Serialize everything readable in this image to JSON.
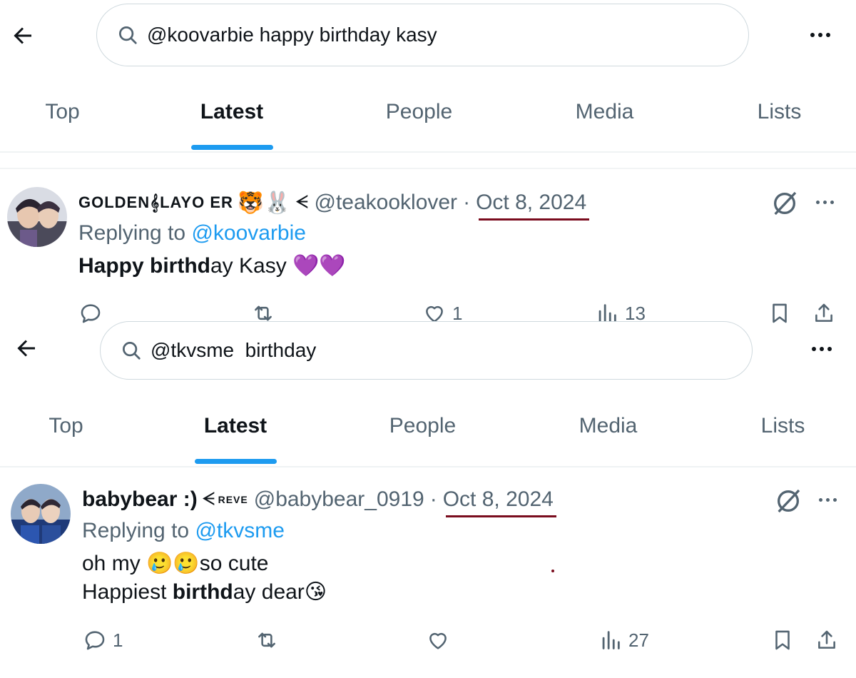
{
  "panels": [
    {
      "search": {
        "query": "@koovarbie happy birthday kasy"
      },
      "tabs": [
        "Top",
        "Latest",
        "People",
        "Media",
        "Lists"
      ],
      "active_tab": "Latest",
      "tweet": {
        "display_name": "GOLDEN𝄞LAYO ER",
        "emojis": "🐯🐰",
        "badge": "ᗕ",
        "handle": "@teakooklover",
        "separator": "·",
        "date": "Oct 8, 2024",
        "replying_prefix": "Replying to",
        "replying_to": "@koovarbie",
        "text_bold": "Happy birthd",
        "text_rest": "ay Kasy 💜💜",
        "replies": "",
        "retweets": "",
        "likes": "1",
        "views": "13"
      }
    },
    {
      "search": {
        "query": "@tkvsme  birthday"
      },
      "tabs": [
        "Top",
        "Latest",
        "People",
        "Media",
        "Lists"
      ],
      "active_tab": "Latest",
      "tweet": {
        "display_name": "babybear :)",
        "badge": "ᗕ",
        "badge_text": "REVE",
        "handle": "@babybear_0919",
        "separator": "·",
        "date": "Oct 8, 2024",
        "replying_prefix": "Replying to",
        "replying_to": "@tkvsme",
        "line1": "oh my 🥲🥲so cute",
        "line2_pre": "Happiest ",
        "line2_bold": "birthd",
        "line2_rest": "ay dear😘",
        "replies": "1",
        "retweets": "",
        "likes": "",
        "views": "27"
      }
    }
  ],
  "icons": [
    "back-arrow-icon",
    "search-icon",
    "more-icon",
    "grok-icon",
    "reply-icon",
    "retweet-icon",
    "like-icon",
    "views-icon",
    "bookmark-icon",
    "share-icon"
  ],
  "colors": {
    "accent": "#1d9bf0",
    "muted": "#536471",
    "text": "#0f1419",
    "underline_mark": "#7a0c1e"
  }
}
